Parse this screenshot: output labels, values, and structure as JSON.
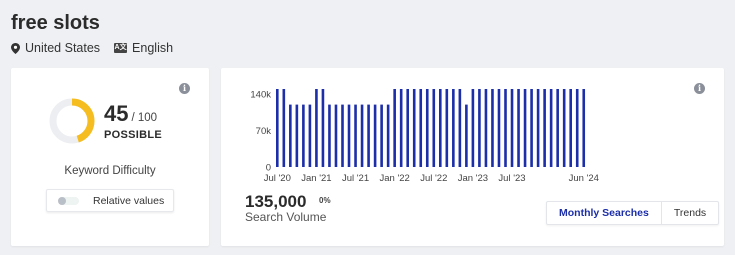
{
  "header": {
    "title": "free slots",
    "location": "United States",
    "language_icon": "A文",
    "language": "English"
  },
  "difficulty": {
    "score": "45",
    "score_max": "/ 100",
    "score_value": 45,
    "level": "POSSIBLE",
    "label": "Keyword Difficulty",
    "relative_label": "Relative values",
    "info": "i",
    "colors": {
      "arc": "#f5bd1f",
      "track": "#eceef1"
    }
  },
  "volume": {
    "value": "135,000",
    "change": "0%",
    "label": "Search Volume",
    "info": "i",
    "tabs": [
      {
        "label": "Monthly Searches"
      },
      {
        "label": "Trends"
      }
    ]
  },
  "chart_data": {
    "type": "bar",
    "title": "",
    "xlabel": "",
    "ylabel": "",
    "ylim": [
      0,
      150000
    ],
    "y_ticks": [
      {
        "value": 0,
        "label": "0"
      },
      {
        "value": 70000,
        "label": "70k"
      },
      {
        "value": 140000,
        "label": "140k"
      }
    ],
    "x_ticks": [
      {
        "index": 0,
        "label": "Jul '20"
      },
      {
        "index": 6,
        "label": "Jan '21"
      },
      {
        "index": 12,
        "label": "Jul '21"
      },
      {
        "index": 18,
        "label": "Jan '22"
      },
      {
        "index": 24,
        "label": "Jul '22"
      },
      {
        "index": 30,
        "label": "Jan '23"
      },
      {
        "index": 36,
        "label": "Jul '23"
      },
      {
        "index": 47,
        "label": "Jun '24"
      }
    ],
    "bar_color": "#1c2ea8",
    "grid": false,
    "values": [
      150000,
      150000,
      120000,
      120000,
      120000,
      120000,
      150000,
      150000,
      120000,
      120000,
      120000,
      120000,
      120000,
      120000,
      120000,
      120000,
      120000,
      120000,
      150000,
      150000,
      150000,
      150000,
      150000,
      150000,
      150000,
      150000,
      150000,
      150000,
      150000,
      120000,
      150000,
      150000,
      150000,
      150000,
      150000,
      150000,
      150000,
      150000,
      150000,
      150000,
      150000,
      150000,
      150000,
      150000,
      150000,
      150000,
      150000,
      150000
    ]
  }
}
